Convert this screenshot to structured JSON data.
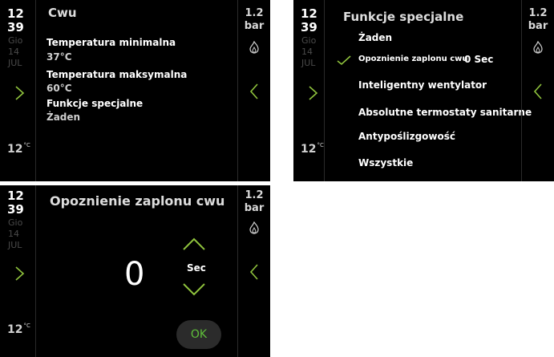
{
  "status": {
    "time_hour": "12",
    "time_min": "39",
    "day": "Gio",
    "date_num": "14",
    "month": "JUL",
    "outdoor_temp": "12",
    "temp_unit": "°C",
    "pressure_value": "1.2",
    "pressure_unit": "bar"
  },
  "screen1": {
    "title": "Cwu",
    "items": [
      {
        "label": "Temperatura minimalna",
        "value": "37°C"
      },
      {
        "label": "Temperatura maksymalna",
        "value": "60°C"
      },
      {
        "label": "Funkcje specjalne",
        "value": "Żaden"
      }
    ]
  },
  "screen2": {
    "title": "Funkcje specjalne",
    "options": [
      {
        "label": "Żaden"
      },
      {
        "label": "Opoznienie zaplonu cwu",
        "value": "0 Sec",
        "selected": true
      },
      {
        "label": "Inteligentny wentylator"
      },
      {
        "label": "Absolutne termostaty sanitarne"
      },
      {
        "label": "Antypoślizgowość"
      },
      {
        "label": "Wszystkie"
      }
    ]
  },
  "screen3": {
    "title": "Opoznienie zaplonu cwu",
    "value": "0",
    "unit": "Sec",
    "ok_label": "OK"
  },
  "colors": {
    "accent_green": "#8fc33d",
    "ok_text": "#5fbf3a",
    "background": "#000000"
  }
}
